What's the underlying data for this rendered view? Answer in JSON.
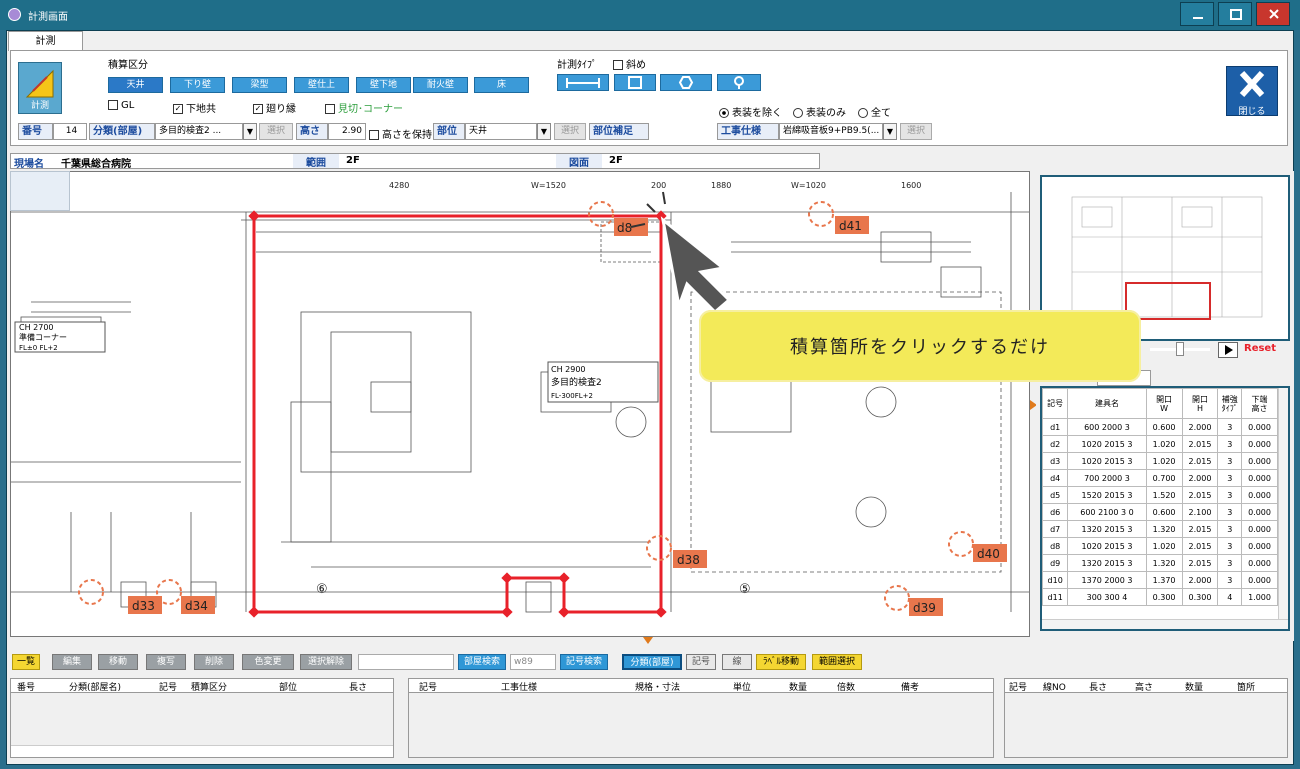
{
  "window": {
    "title": "計測画面"
  },
  "tabs": [
    {
      "label": "計測"
    }
  ],
  "measure_button": {
    "label": "計測"
  },
  "category": {
    "title": "積算区分",
    "buttons": [
      "天井",
      "下り壁",
      "梁型",
      "壁仕上",
      "壁下地",
      "耐火壁",
      "床"
    ],
    "selected": "天井",
    "checks": [
      {
        "label": "GL",
        "checked": false
      },
      {
        "label": "下地共",
        "checked": true
      },
      {
        "label": "廻り縁",
        "checked": true
      },
      {
        "label": "見切･コーナー",
        "checked": false
      }
    ]
  },
  "measure_type": {
    "title": "計測ﾀｲﾌﾟ",
    "oblique_label": "斜め",
    "oblique_checked": false,
    "radios": [
      {
        "label": "表装を除く",
        "on": true
      },
      {
        "label": "表装のみ",
        "on": false
      },
      {
        "label": "全て",
        "on": false
      }
    ]
  },
  "fields": {
    "number_label": "番号",
    "number_value": "14",
    "class_label": "分類(部屋)",
    "class_value": "多目的検査2 ...",
    "select_label": "選択",
    "height_label": "高さ",
    "height_value": "2.90",
    "keep_height": "高さを保持",
    "part_label": "部位",
    "part_value": "天井",
    "part_supp_label": "部位補足",
    "spec_label": "工事仕様",
    "spec_value": "岩綿吸音板9+PB9.5(..."
  },
  "close_button": {
    "label": "閉じる"
  },
  "infobar": {
    "site_label": "現場名",
    "site_value": "千葉県総合病院",
    "range_label": "範囲",
    "range_value": "2F",
    "drawing_label": "図面",
    "drawing_value": "2F"
  },
  "callout": {
    "text": "積算箇所をクリックするだけ"
  },
  "minimap": {
    "reset_label": "Reset"
  },
  "fittings_table": {
    "columns": [
      "記号",
      "建具名",
      "開口\nW",
      "開口\nH",
      "補強\nﾀｲﾌﾟ",
      "下端\n高さ"
    ],
    "rows": [
      [
        "d1",
        "600 2000 3",
        "0.600",
        "2.000",
        "3",
        "0.000"
      ],
      [
        "d2",
        "1020 2015 3",
        "1.020",
        "2.015",
        "3",
        "0.000"
      ],
      [
        "d3",
        "1020 2015 3",
        "1.020",
        "2.015",
        "3",
        "0.000"
      ],
      [
        "d4",
        "700 2000 3",
        "0.700",
        "2.000",
        "3",
        "0.000"
      ],
      [
        "d5",
        "1520 2015 3",
        "1.520",
        "2.015",
        "3",
        "0.000"
      ],
      [
        "d6",
        "600 2100 3 0",
        "0.600",
        "2.100",
        "3",
        "0.000"
      ],
      [
        "d7",
        "1320 2015 3",
        "1.320",
        "2.015",
        "3",
        "0.000"
      ],
      [
        "d8",
        "1020 2015 3",
        "1.020",
        "2.015",
        "3",
        "0.000"
      ],
      [
        "d9",
        "1320 2015 3",
        "1.320",
        "2.015",
        "3",
        "0.000"
      ],
      [
        "d10",
        "1370 2000 3",
        "1.370",
        "2.000",
        "3",
        "0.000"
      ],
      [
        "d11",
        "300 300 4",
        "0.300",
        "0.300",
        "4",
        "1.000"
      ]
    ]
  },
  "drawing": {
    "dims": [
      "4280",
      "W=1520",
      "200",
      "1880",
      "W=1020",
      "1600"
    ],
    "room_a": {
      "line1": "CH 2900",
      "line2": "多目的検査2",
      "line3": "FL-300FL+2"
    },
    "room_b": {
      "line1": "CH 2700",
      "line2": "準備コーナー",
      "line3": "FL±0  FL+2"
    },
    "markers": [
      "d8",
      "d41",
      "d33",
      "d34",
      "d38",
      "d40",
      "d39"
    ],
    "circled": [
      "⑥",
      "⑤"
    ]
  },
  "bottom_toolbar": {
    "buttons": [
      "一覧",
      "編集",
      "移動",
      "複写",
      "削除",
      "色変更",
      "選択解除"
    ],
    "search_btn": "部屋検索",
    "w_value": "w89",
    "symbol_search": "記号検索",
    "toggles": [
      "分類(部屋)",
      "記号",
      "線",
      "ﾗﾍﾞﾙ移動",
      "範囲選択"
    ]
  },
  "grids": {
    "left_headers": [
      "番号",
      "分類(部屋名)",
      "記号",
      "積算区分",
      "部位",
      "長さ"
    ],
    "middle_headers": [
      "記号",
      "工事仕様",
      "規格・寸法",
      "単位",
      "数量",
      "倍数",
      "備考"
    ],
    "right_headers": [
      "記号",
      "線NO",
      "長さ",
      "高さ",
      "数量",
      "箇所"
    ]
  },
  "colors": {
    "accent_blue": "#3b9ad8",
    "selection_red": "#e8212a",
    "marker_orange": "#e8764c",
    "callout_yellow": "#f3ea59"
  }
}
